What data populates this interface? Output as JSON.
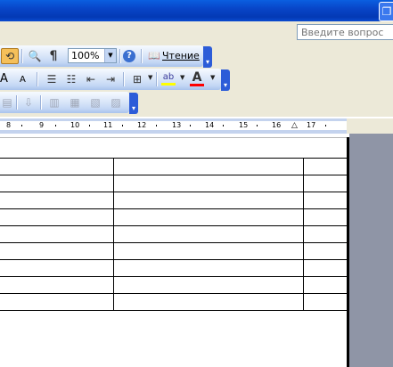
{
  "help": {
    "placeholder": "Введите вопрос"
  },
  "toolbar1": {
    "zoom": "100%",
    "reading_label": "Чтение",
    "icons": [
      "research-icon",
      "print-preview-icon",
      "show-formatting-icon",
      "zoom-dropdown",
      "help-icon",
      "reading-layout-icon"
    ]
  },
  "toolbar2": {
    "font_grow": "A",
    "font_shrink": "A",
    "icons": [
      "grow-font-icon",
      "shrink-font-icon",
      "numbering-icon",
      "bullets-icon",
      "decrease-indent-icon",
      "increase-indent-icon",
      "borders-icon",
      "highlight-icon",
      "font-color-icon"
    ]
  },
  "toolbar3": {
    "icons": [
      "disabled-tool-1",
      "disabled-tool-2",
      "disabled-tool-3",
      "disabled-tool-4",
      "disabled-tool-5"
    ]
  },
  "ruler": {
    "numbers": [
      "8",
      "9",
      "10",
      "11",
      "12",
      "13",
      "14",
      "15",
      "16",
      "17"
    ]
  },
  "colors": {
    "title_bar": "#0845c8",
    "toolbar_blue": "#c3d6f4",
    "chevron": "#2c5cd8",
    "gray_pane": "#8f95a6"
  }
}
